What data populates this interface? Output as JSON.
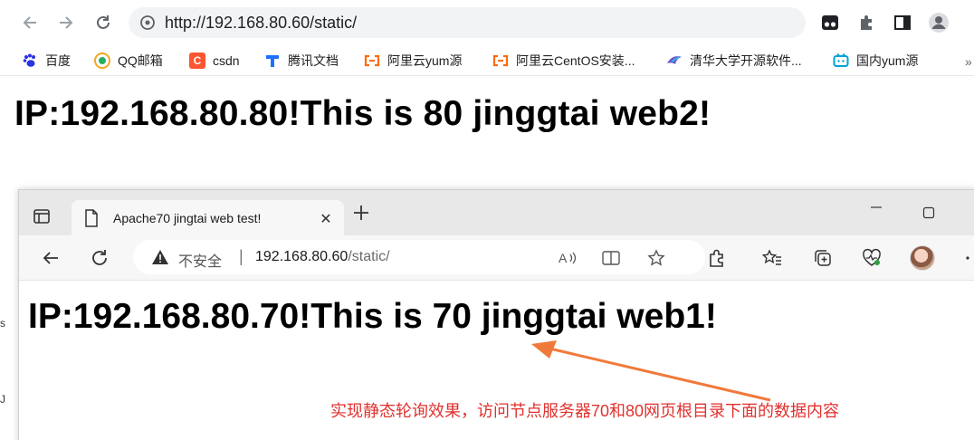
{
  "back_browser": {
    "url": "http://192.168.80.60/static/",
    "bookmarks": [
      {
        "label": "百度",
        "icon": "baidu-paw-icon",
        "color": "#2932e1"
      },
      {
        "label": "QQ邮箱",
        "icon": "qq-mail-icon",
        "color": "#f5a623"
      },
      {
        "label": "csdn",
        "icon": "csdn-icon",
        "color": "#fc5531"
      },
      {
        "label": "腾讯文档",
        "icon": "tencent-docs-icon",
        "color": "#1e6fff"
      },
      {
        "label": "阿里云yum源",
        "icon": "aliyun-icon",
        "color": "#ff6a00"
      },
      {
        "label": "阿里云CentOS安装...",
        "icon": "aliyun-icon",
        "color": "#ff6a00"
      },
      {
        "label": "清华大学开源软件...",
        "icon": "tsinghua-tuna-icon",
        "color": "#6a5acd"
      },
      {
        "label": "国内yum源",
        "icon": "bilibili-tv-icon",
        "color": "#00a1d6"
      }
    ],
    "more_label": "»",
    "heading": "IP:192.168.80.80!This is 80 jinggtai web2!"
  },
  "front_browser": {
    "tab_title": "Apache70 jingtai web test!",
    "insecure_label": "不安全",
    "url_host": "192.168.80.60",
    "url_path": "/static/",
    "heading": "IP:192.168.80.70!This is 70 jinggtai web1!"
  },
  "annotation": {
    "text": "实现静态轮询效果，访问节点服务器70和80网页根目录下面的数据内容",
    "color": "#e0312e",
    "arrow_color": "#f07a3a"
  },
  "left_edge": {
    "top_char": "s",
    "bottom_char": "J"
  }
}
